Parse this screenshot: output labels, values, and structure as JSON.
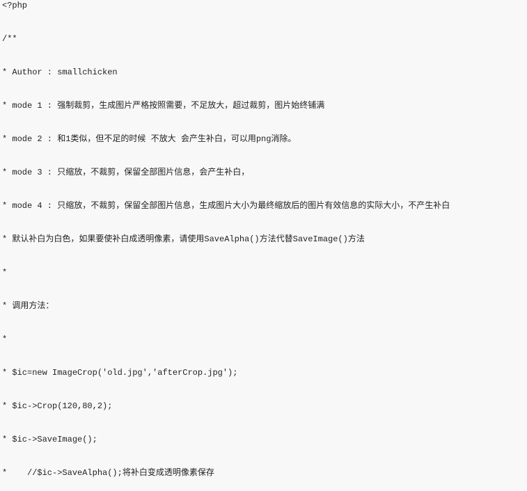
{
  "document": {
    "lines": [
      "<?php",
      "/**",
      "* Author : smallchicken",
      "* mode 1 : 强制裁剪，生成图片严格按照需要，不足放大，超过裁剪，图片始终铺满",
      "* mode 2 : 和1类似，但不足的时候 不放大 会产生补白，可以用png消除。",
      "* mode 3 : 只缩放，不裁剪，保留全部图片信息，会产生补白，",
      "* mode 4 : 只缩放，不裁剪，保留全部图片信息，生成图片大小为最终缩放后的图片有效信息的实际大小，不产生补白",
      "* 默认补白为白色，如果要使补白成透明像素，请使用SaveAlpha()方法代替SaveImage()方法",
      "*",
      "* 调用方法：",
      "*",
      "* $ic=new ImageCrop('old.jpg','afterCrop.jpg');",
      "* $ic->Crop(120,80,2);",
      "* $ic->SaveImage();",
      "*    //$ic->SaveAlpha();将补白变成透明像素保存"
    ]
  }
}
